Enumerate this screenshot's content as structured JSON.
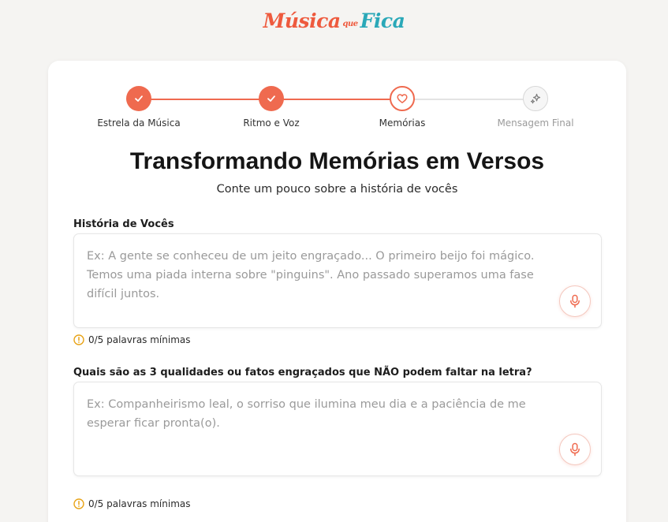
{
  "brand": {
    "part1": "Música",
    "part2": "que",
    "part3": "Fica"
  },
  "stepper": {
    "steps": [
      {
        "label": "Estrela da Música",
        "state": "done"
      },
      {
        "label": "Ritmo e Voz",
        "state": "done"
      },
      {
        "label": "Memórias",
        "state": "current"
      },
      {
        "label": "Mensagem Final",
        "state": "future"
      }
    ]
  },
  "page": {
    "title": "Transformando Memórias em Versos",
    "subtitle": "Conte um pouco sobre a história de vocês"
  },
  "fields": [
    {
      "label": "História de Vocês",
      "placeholder": "Ex: A gente se conheceu de um jeito engraçado... O primeiro beijo foi mágico. Temos uma piada interna sobre \"pinguins\". Ano passado superamos uma fase difícil juntos.",
      "value": "",
      "counter": "0/5 palavras mínimas"
    },
    {
      "label": "Quais são as 3 qualidades ou fatos engraçados que NÃO podem faltar na letra?",
      "placeholder": "Ex: Companheirismo leal, o sorriso que ilumina meu dia e a paciência de me esperar ficar pronta(o).",
      "value": "",
      "counter": "0/5 palavras mínimas"
    }
  ],
  "colors": {
    "accent": "#ef6a4f",
    "brand_teal": "#2aa8b8",
    "warning": "#e8a317",
    "background": "#f5f4f2"
  },
  "icons": {
    "step_done": "check-icon",
    "step_current": "heart-icon",
    "step_future": "sparkles-icon",
    "mic": "microphone-icon",
    "warning": "alert-circle-icon"
  }
}
